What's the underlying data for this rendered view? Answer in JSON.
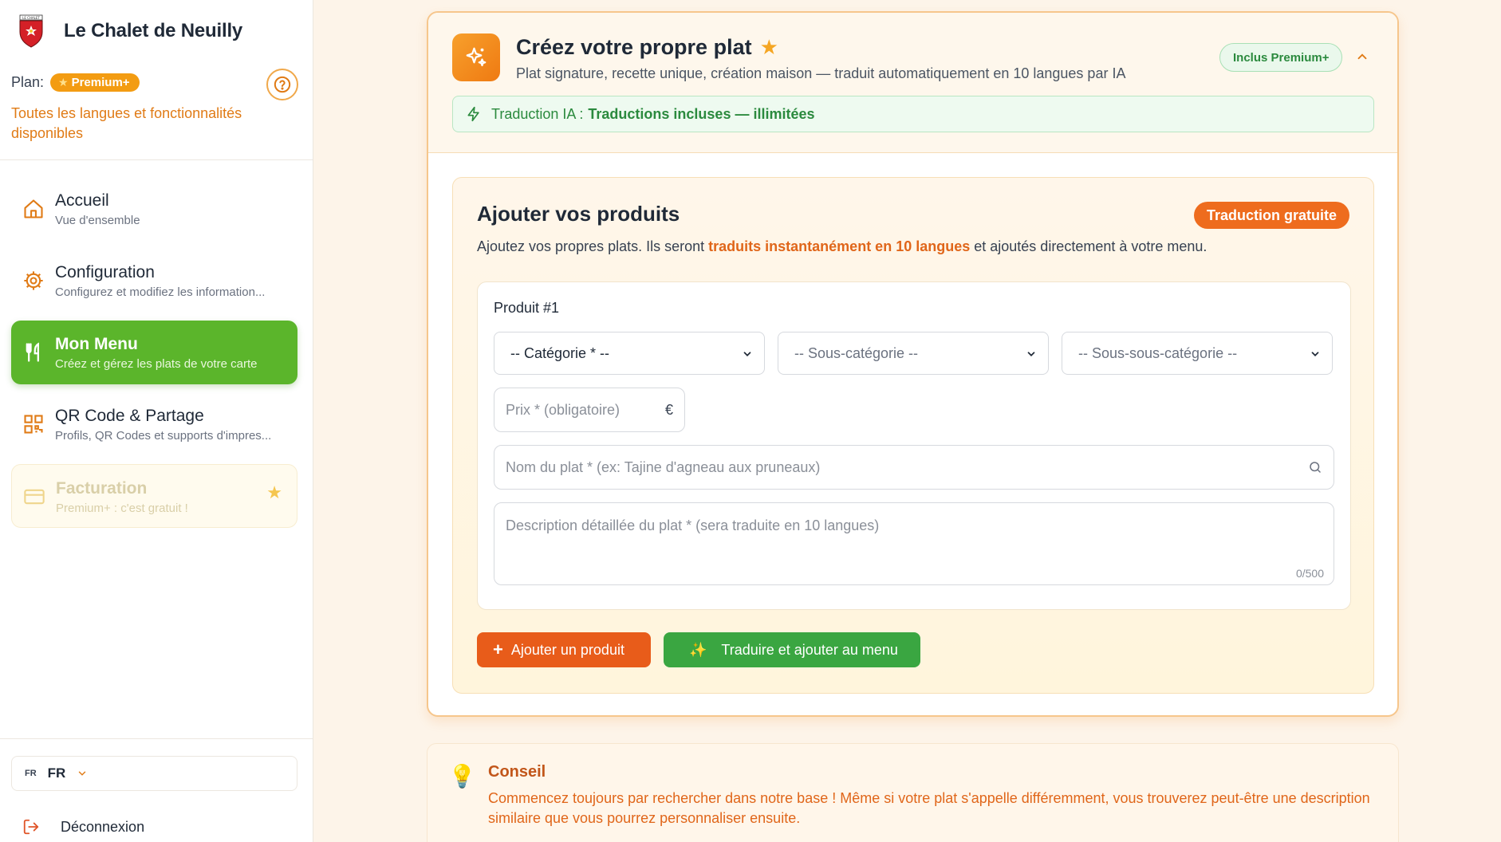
{
  "sidebar": {
    "restaurant_name": "Le Chalet de Neuilly",
    "logo_text": "LE CHALET",
    "plan_label": "Plan:",
    "plan_badge": "Premium+",
    "plan_note": "Toutes les langues et fonctionnalités disponibles",
    "nav": [
      {
        "title": "Accueil",
        "subtitle": "Vue d'ensemble",
        "icon": "home-icon",
        "active": false
      },
      {
        "title": "Configuration",
        "subtitle": "Configurez et modifiez les information...",
        "icon": "gear-icon",
        "active": false
      },
      {
        "title": "Mon Menu",
        "subtitle": "Créez et gérez les plats de votre carte",
        "icon": "utensils-icon",
        "active": true
      },
      {
        "title": "QR Code & Partage",
        "subtitle": "Profils, QR Codes et supports d'impres...",
        "icon": "qrcode-icon",
        "active": false
      },
      {
        "title": "Facturation",
        "subtitle": "Premium+ : c'est gratuit !",
        "icon": "credit-card-icon",
        "active": false,
        "disabled": true
      }
    ],
    "language": {
      "small": "FR",
      "code": "FR"
    },
    "logout": "Déconnexion"
  },
  "card": {
    "title": "Créez votre propre plat",
    "subtitle": "Plat signature, recette unique, création maison — traduit automatiquement en 10 langues par IA",
    "included_badge": "Inclus Premium+",
    "ai_label": "Traduction IA :",
    "ai_value": "Traductions incluses — illimitées"
  },
  "panel": {
    "title": "Ajouter vos produits",
    "badge": "Traduction gratuite",
    "desc_before": "Ajoutez vos propres plats. Ils seront",
    "desc_highlight": "traduits instantanément en 10 langues",
    "desc_after": "et ajoutés directement à votre menu.",
    "product": {
      "label": "Produit #1",
      "category": "-- Catégorie * --",
      "subcategory": "-- Sous-catégorie --",
      "subsubcategory": "-- Sous-sous-catégorie --",
      "price_placeholder": "Prix * (obligatoire)",
      "currency": "€",
      "name_placeholder": "Nom du plat * (ex: Tajine d'agneau aux pruneaux)",
      "description_placeholder": "Description détaillée du plat * (sera traduite en 10 langues)",
      "char_count": "0/500"
    },
    "add_button": "Ajouter un produit",
    "translate_button": "Traduire et ajouter au menu"
  },
  "tip": {
    "title": "Conseil",
    "text": "Commencez toujours par rechercher dans notre base ! Même si votre plat s'appelle différemment, vous trouverez peut-être une description similaire que vous pourrez personnaliser ensuite."
  },
  "colors": {
    "accent_orange": "#ee6c1e",
    "active_green": "#5bb52b",
    "success_green": "#3aa641",
    "premium_gold": "#f39c12"
  }
}
